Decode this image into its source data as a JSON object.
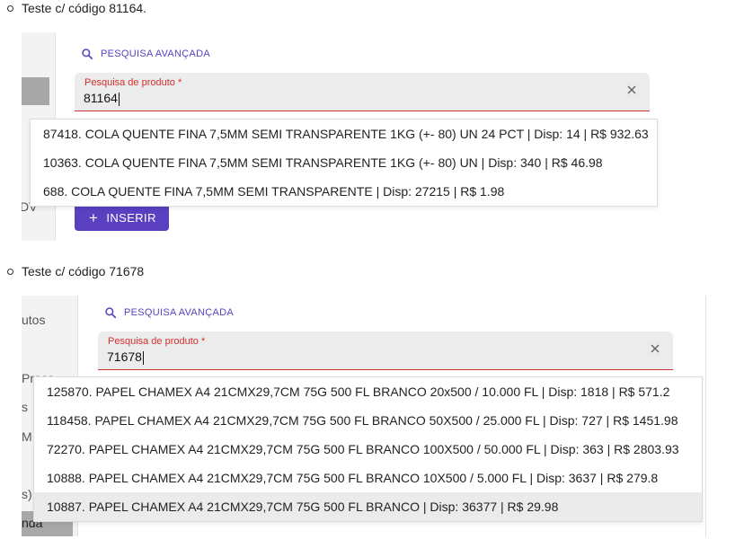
{
  "case1": {
    "heading": "Teste c/ código 81164.",
    "sidebar_fragment": "DV",
    "advanced_search_label": "PESQUISA AVANÇADA",
    "field_label": "Pesquisa de produto *",
    "field_value": "81164",
    "options": [
      "87418. COLA QUENTE FINA 7,5MM SEMI TRANSPARENTE 1KG (+- 80) UN 24 PCT | Disp: 14 | R$ 932.63",
      "10363. COLA QUENTE FINA 7,5MM SEMI TRANSPARENTE 1KG (+- 80) UN | Disp: 340 | R$ 46.98",
      "688. COLA QUENTE FINA 7,5MM SEMI TRANSPARENTE | Disp: 27215 | R$ 1.98"
    ],
    "insert_label": "INSERIR"
  },
  "case2": {
    "heading": "Teste c/ código 71678",
    "sidebar_fragments": [
      "utos",
      "Proce",
      "s",
      "M",
      "s)",
      "nda"
    ],
    "advanced_search_label": "PESQUISA AVANÇADA",
    "field_label": "Pesquisa de produto *",
    "field_value": "71678",
    "options": [
      "125870. PAPEL CHAMEX A4 21CMX29,7CM 75G 500 FL BRANCO 20x500 / 10.000 FL | Disp: 1818 | R$ 571.2",
      "118458. PAPEL CHAMEX A4 21CMX29,7CM 75G 500 FL BRANCO 50X500 / 25.000 FL | Disp: 727 | R$ 1451.98",
      "72270. PAPEL CHAMEX A4 21CMX29,7CM 75G 500 FL BRANCO 100X500 / 50.000 FL | Disp: 363 | R$ 2803.93",
      "10888. PAPEL CHAMEX A4 21CMX29,7CM 75G 500 FL BRANCO 10X500 / 5.000 FL | Disp: 3637 | R$ 279.8",
      "10887. PAPEL CHAMEX A4 21CMX29,7CM 75G 500 FL BRANCO | Disp: 36377 | R$ 29.98"
    ]
  },
  "colors": {
    "accent": "#5a3fc0",
    "error": "#d32f2f",
    "field_bg": "#ececec",
    "highlight": "#ebebeb"
  },
  "icons": {
    "search": "search-icon",
    "clear": "close-icon",
    "add": "plus-icon"
  }
}
